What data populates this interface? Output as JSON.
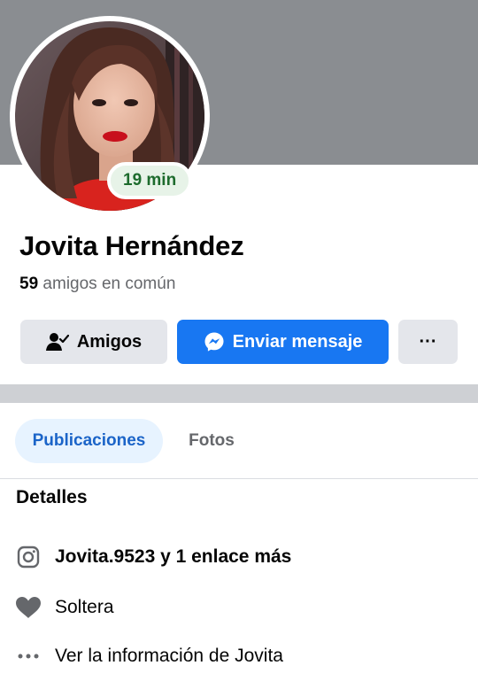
{
  "profile": {
    "name": "Jovita Hernández",
    "active_badge": "19 min",
    "mutual_count": "59",
    "mutual_label": " amigos en común"
  },
  "actions": {
    "friends_label": "Amigos",
    "message_label": "Enviar mensaje",
    "more_label": "···"
  },
  "tabs": [
    {
      "label": "Publicaciones",
      "active": true
    },
    {
      "label": "Fotos",
      "active": false
    }
  ],
  "details": {
    "title": "Detalles",
    "items": [
      {
        "icon": "instagram-icon",
        "text": "Jovita.9523 y 1 enlace más"
      },
      {
        "icon": "heart-icon",
        "text": "Soltera"
      },
      {
        "icon": "more-dots-icon",
        "text": "Ver la información de Jovita"
      }
    ]
  },
  "colors": {
    "cover": "#8a8d91",
    "primary": "#1877f2",
    "secondary_button": "#e4e6eb",
    "active_tab_bg": "#e7f3ff",
    "active_tab_text": "#1b64c8",
    "badge_bg": "#e7f3e8",
    "badge_text": "#1d6b2d"
  }
}
